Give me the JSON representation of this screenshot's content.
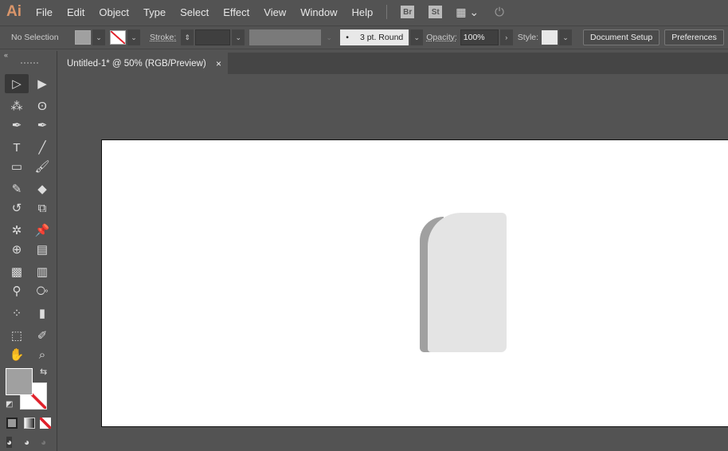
{
  "app": {
    "logo": "Ai"
  },
  "menu": [
    "File",
    "Edit",
    "Object",
    "Type",
    "Select",
    "Effect",
    "View",
    "Window",
    "Help"
  ],
  "menu_icons": {
    "bridge": "Br",
    "stock": "St"
  },
  "control": {
    "selection": "No Selection",
    "stroke_label": "Stroke:",
    "brush": "3 pt. Round",
    "opacity_label": "Opacity:",
    "opacity": "100%",
    "style_label": "Style:",
    "document_setup": "Document Setup",
    "preferences": "Preferences"
  },
  "tab": {
    "title": "Untitled-1* @ 50% (RGB/Preview)",
    "close": "×"
  },
  "colors": {
    "fill": "#a0a0a0",
    "shape_face": "#e4e4e4",
    "shape_shade": "#a0a0a0",
    "stroke_none": "#e0202a"
  },
  "tools": [
    "selection",
    "direct-selection",
    "magic-wand",
    "lasso",
    "pen",
    "curvature",
    "type",
    "line-segment",
    "rectangle",
    "paintbrush",
    "shaper",
    "eraser",
    "rotate",
    "scale",
    "puppet-warp",
    "pin",
    "shape-builder",
    "perspective-grid",
    "mesh",
    "gradient",
    "eyedropper",
    "blend",
    "symbol-sprayer",
    "column-graph",
    "artboard",
    "slice",
    "hand",
    "zoom"
  ]
}
